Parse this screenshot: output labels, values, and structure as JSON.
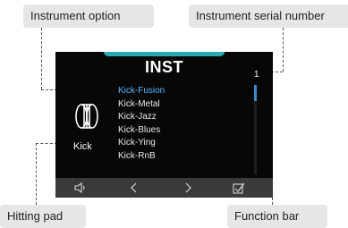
{
  "callouts": {
    "instrument_option": "Instrument option",
    "serial_number": "Instrument serial number",
    "hitting_pad": "Hitting pad",
    "function_bar": "Function bar"
  },
  "screen": {
    "title": "INST",
    "serial_number": "1",
    "selected_index": 0,
    "instruments": [
      "Kick-Fusion",
      "Kick-Metal",
      "Kick-Jazz",
      "Kick-Blues",
      "Kick-Ying",
      "Kick-RnB"
    ],
    "pad_name": "Kick",
    "pad_icon": "bass-drum-icon",
    "accent_color": "#29a9b4",
    "selected_color": "#5cb6ff"
  },
  "function_bar": {
    "buttons": [
      {
        "name": "speaker-icon"
      },
      {
        "name": "left-arrow-icon"
      },
      {
        "name": "right-arrow-icon"
      },
      {
        "name": "checkbox-icon"
      }
    ]
  }
}
